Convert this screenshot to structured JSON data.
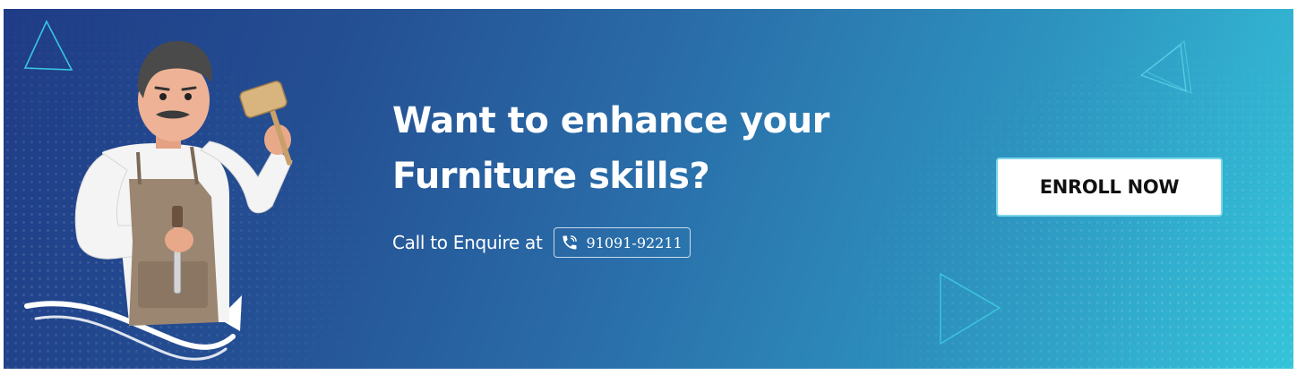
{
  "banner": {
    "headline": "Want to enhance your Furniture skills?",
    "enquire_label": "Call to Enquire at",
    "phone_number": "91091-92211",
    "phone_icon": "phone-call-icon",
    "cta_label": "ENROLL NOW",
    "illustration": "carpenter-with-mallet-and-chisel",
    "colors": {
      "gradient_start": "#1f3c86",
      "gradient_end": "#35c4da",
      "text": "#ffffff",
      "button_bg": "#ffffff",
      "button_border": "#7cd7ec",
      "button_text": "#111111"
    }
  }
}
